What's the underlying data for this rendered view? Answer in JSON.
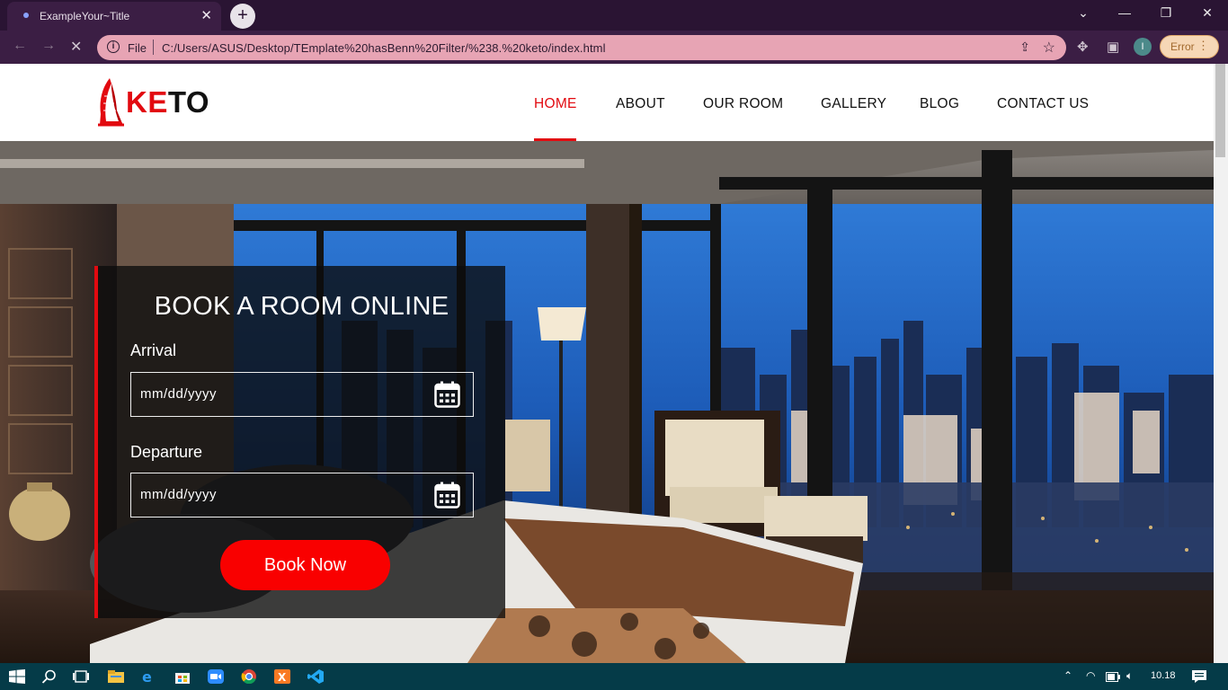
{
  "browser": {
    "tab_title": "ExampleYour~Title",
    "new_tab_icon": "+",
    "url_scheme_label": "File",
    "url": "C:/Users/ASUS/Desktop/TEmplate%20hasBenn%20Filter/%238.%20keto/index.html",
    "error_label": "Error",
    "profile_initial": "I"
  },
  "site": {
    "logo_text_red": "KE",
    "logo_text_black": "TO",
    "logo_accent": "#e20a10",
    "nav": [
      {
        "label": "HOME",
        "active": true
      },
      {
        "label": "ABOUT",
        "active": false
      },
      {
        "label": "OUR ROOM",
        "active": false
      },
      {
        "label": "GALLERY",
        "active": false
      },
      {
        "label": "BLOG",
        "active": false
      },
      {
        "label": "CONTACT US",
        "active": false
      }
    ]
  },
  "booking": {
    "title": "BOOK A ROOM ONLINE",
    "arrival_label": "Arrival",
    "arrival_placeholder": "mm/dd/yyyy",
    "departure_label": "Departure",
    "departure_placeholder": "mm/dd/yyyy",
    "button_label": "Book Now",
    "button_color": "#f90000"
  },
  "taskbar": {
    "time": "10.18"
  }
}
